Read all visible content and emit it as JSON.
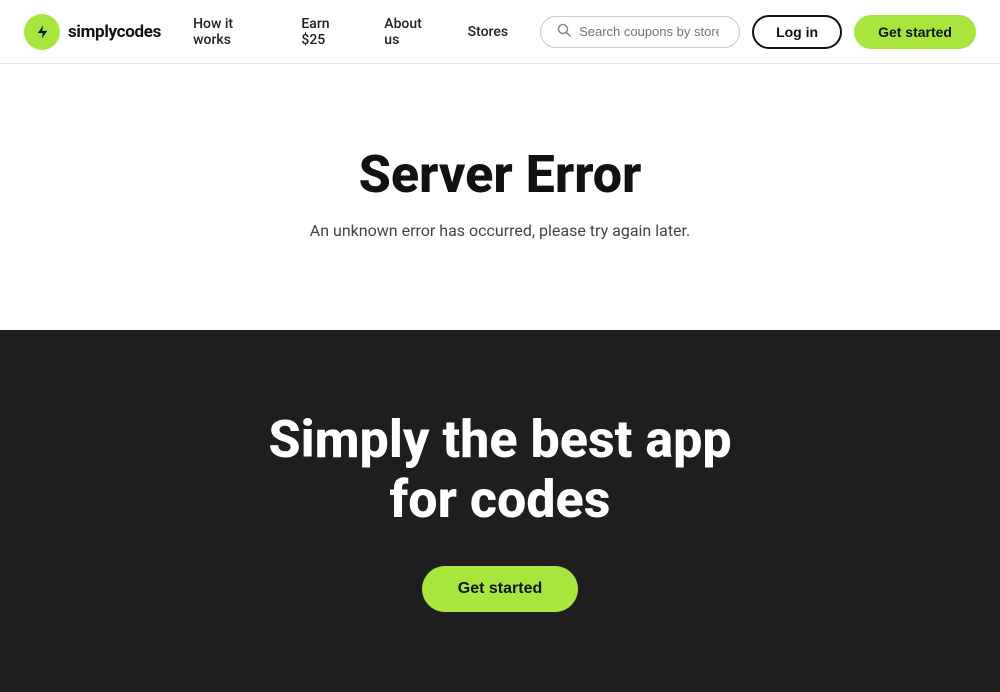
{
  "brand": {
    "logo_emoji": "⚡",
    "name": "simplycodes"
  },
  "navbar": {
    "links": [
      {
        "label": "How it works",
        "id": "how-it-works"
      },
      {
        "label": "Earn $25",
        "id": "earn"
      },
      {
        "label": "About us",
        "id": "about"
      },
      {
        "label": "Stores",
        "id": "stores"
      }
    ],
    "search_placeholder": "Search coupons by store",
    "login_label": "Log in",
    "get_started_label": "Get started"
  },
  "error_section": {
    "title": "Server Error",
    "subtitle": "An unknown error has occurred, please try again later."
  },
  "promo_section": {
    "title_line1": "Simply the best app",
    "title_line2": "for codes",
    "cta_label": "Get started"
  },
  "colors": {
    "accent": "#a8e63d",
    "dark_bg": "#1e1e1e"
  }
}
